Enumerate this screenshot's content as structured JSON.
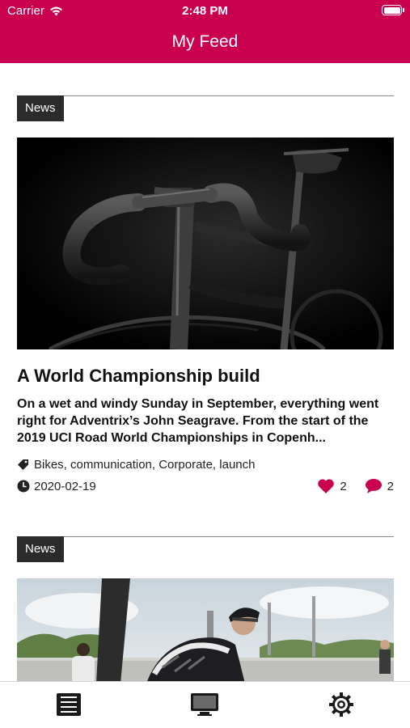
{
  "status_bar": {
    "carrier": "Carrier",
    "time": "2:48 PM",
    "wifi_icon": "wifi-icon",
    "battery_icon": "battery-full-icon"
  },
  "nav": {
    "title": "My Feed"
  },
  "articles": [
    {
      "category": "News",
      "title": "A World Championship build",
      "summary": "On a wet and windy Sunday in September, everything went right for Adventrix’s John Seagrave. From the start of the 2019 UCI Road World Championships in Copenh...",
      "tags": "Bikes, communication, Corporate, launch",
      "date": "2020-02-19",
      "likes": "2",
      "comments": "2",
      "image_icon": "bike-handlebar-photo"
    },
    {
      "category": "News",
      "image_icon": "cyclist-race-photo"
    }
  ],
  "tab_bar": {
    "items": [
      {
        "icon": "feed-list-icon"
      },
      {
        "icon": "monitor-icon"
      },
      {
        "icon": "settings-gear-icon"
      }
    ]
  },
  "colors": {
    "brand": "#C8004F",
    "tag_bg": "#2b2b2b",
    "heart": "#C8004F",
    "comment": "#C8004F"
  }
}
